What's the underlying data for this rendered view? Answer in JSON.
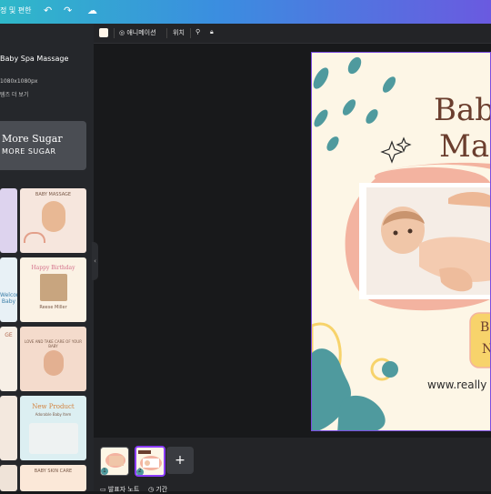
{
  "topbar": {
    "menu_label": "정 및 편한",
    "undo_icon": "undo-icon",
    "redo_icon": "redo-icon",
    "cloud_icon": "cloud-icon"
  },
  "sidebar": {
    "template_title": "Baby Spa Massage",
    "template_size": "1080x1080px",
    "template_more": "템즈 더 보기",
    "font_preview": {
      "line1": "More Sugar",
      "line2": "MORE SUGAR"
    },
    "templates": [
      {
        "label": "BABY MASSAGE"
      },
      {
        "label": "Happy Birthday"
      },
      {
        "label": "Welcome Baby"
      },
      {
        "label": "Reese Miller"
      },
      {
        "label": "GE"
      },
      {
        "label": "LOVE AND TAKE CARE OF YOUR BABY"
      },
      {
        "label": "New Product"
      },
      {
        "label": "Adorable Baby Item"
      },
      {
        "label": "BABY SKIN CARE"
      }
    ]
  },
  "context_toolbar": {
    "color_value": "#fdf6e6",
    "animation_label": "애니메이션",
    "position_label": "위치",
    "paint_icon": "paint-roller-icon",
    "lock_icon": "lock-icon"
  },
  "canvas": {
    "heading_line1": "Bab",
    "heading_line2": "Mas",
    "badge_line1": "B",
    "badge_line2": "N",
    "website": "www.really",
    "colors": {
      "teal": "#4f9a9e",
      "peach": "#f3b3a0",
      "yellow": "#f7d36b",
      "brown": "#6b3e2e",
      "cream": "#fdf6e6"
    }
  },
  "bottom_bar": {
    "pages": [
      {
        "number": "1"
      },
      {
        "number": "2"
      }
    ],
    "add_page_label": "+",
    "notes_label": "발표자 노트",
    "duration_label": "기간"
  }
}
